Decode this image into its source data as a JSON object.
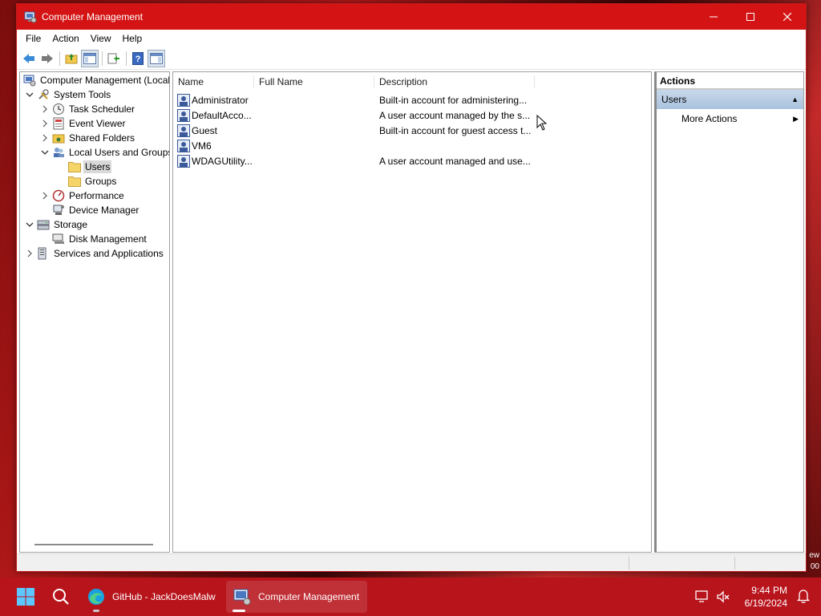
{
  "window": {
    "title": "Computer Management",
    "controls": {
      "minimize": "—",
      "maximize": "☐",
      "close": "✕"
    }
  },
  "menu": [
    "File",
    "Action",
    "View",
    "Help"
  ],
  "toolbar_icons": [
    "back-arrow-icon",
    "forward-arrow-icon",
    "up-folder-icon",
    "show-hide-tree-icon",
    "export-list-icon",
    "help-icon",
    "show-hide-action-pane-icon"
  ],
  "tree": {
    "root": "Computer Management (Local",
    "items": [
      {
        "label": "System Tools",
        "expanded": true
      },
      {
        "label": "Task Scheduler"
      },
      {
        "label": "Event Viewer"
      },
      {
        "label": "Shared Folders"
      },
      {
        "label": "Local Users and Groups",
        "expanded": true
      },
      {
        "label": "Users",
        "selected": true
      },
      {
        "label": "Groups"
      },
      {
        "label": "Performance"
      },
      {
        "label": "Device Manager"
      },
      {
        "label": "Storage",
        "expanded": true
      },
      {
        "label": "Disk Management"
      },
      {
        "label": "Services and Applications"
      }
    ]
  },
  "list": {
    "columns": [
      "Name",
      "Full Name",
      "Description"
    ],
    "rows": [
      {
        "name": "Administrator",
        "full_name": "",
        "description": "Built-in account for administering..."
      },
      {
        "name": "DefaultAcco...",
        "full_name": "",
        "description": "A user account managed by the s..."
      },
      {
        "name": "Guest",
        "full_name": "",
        "description": "Built-in account for guest access t..."
      },
      {
        "name": "VM6",
        "full_name": "",
        "description": ""
      },
      {
        "name": "WDAGUtility...",
        "full_name": "",
        "description": "A user account managed and use..."
      }
    ]
  },
  "actions": {
    "title": "Actions",
    "group": "Users",
    "items": [
      "More Actions"
    ]
  },
  "taskbar": {
    "tasks": [
      {
        "label": "GitHub - JackDoesMalw",
        "icon": "edge-browser-icon"
      },
      {
        "label": "Computer Management",
        "icon": "computer-management-icon",
        "active": true
      }
    ],
    "time": "9:44 PM",
    "date": "6/19/2024"
  },
  "desktop_edge_text": [
    "ew",
    "00"
  ],
  "colors": {
    "titlebar": "#d41414",
    "taskbar": "#b8141c",
    "selection": "#d9d9d9",
    "actions_group": "#b4c9e2"
  }
}
